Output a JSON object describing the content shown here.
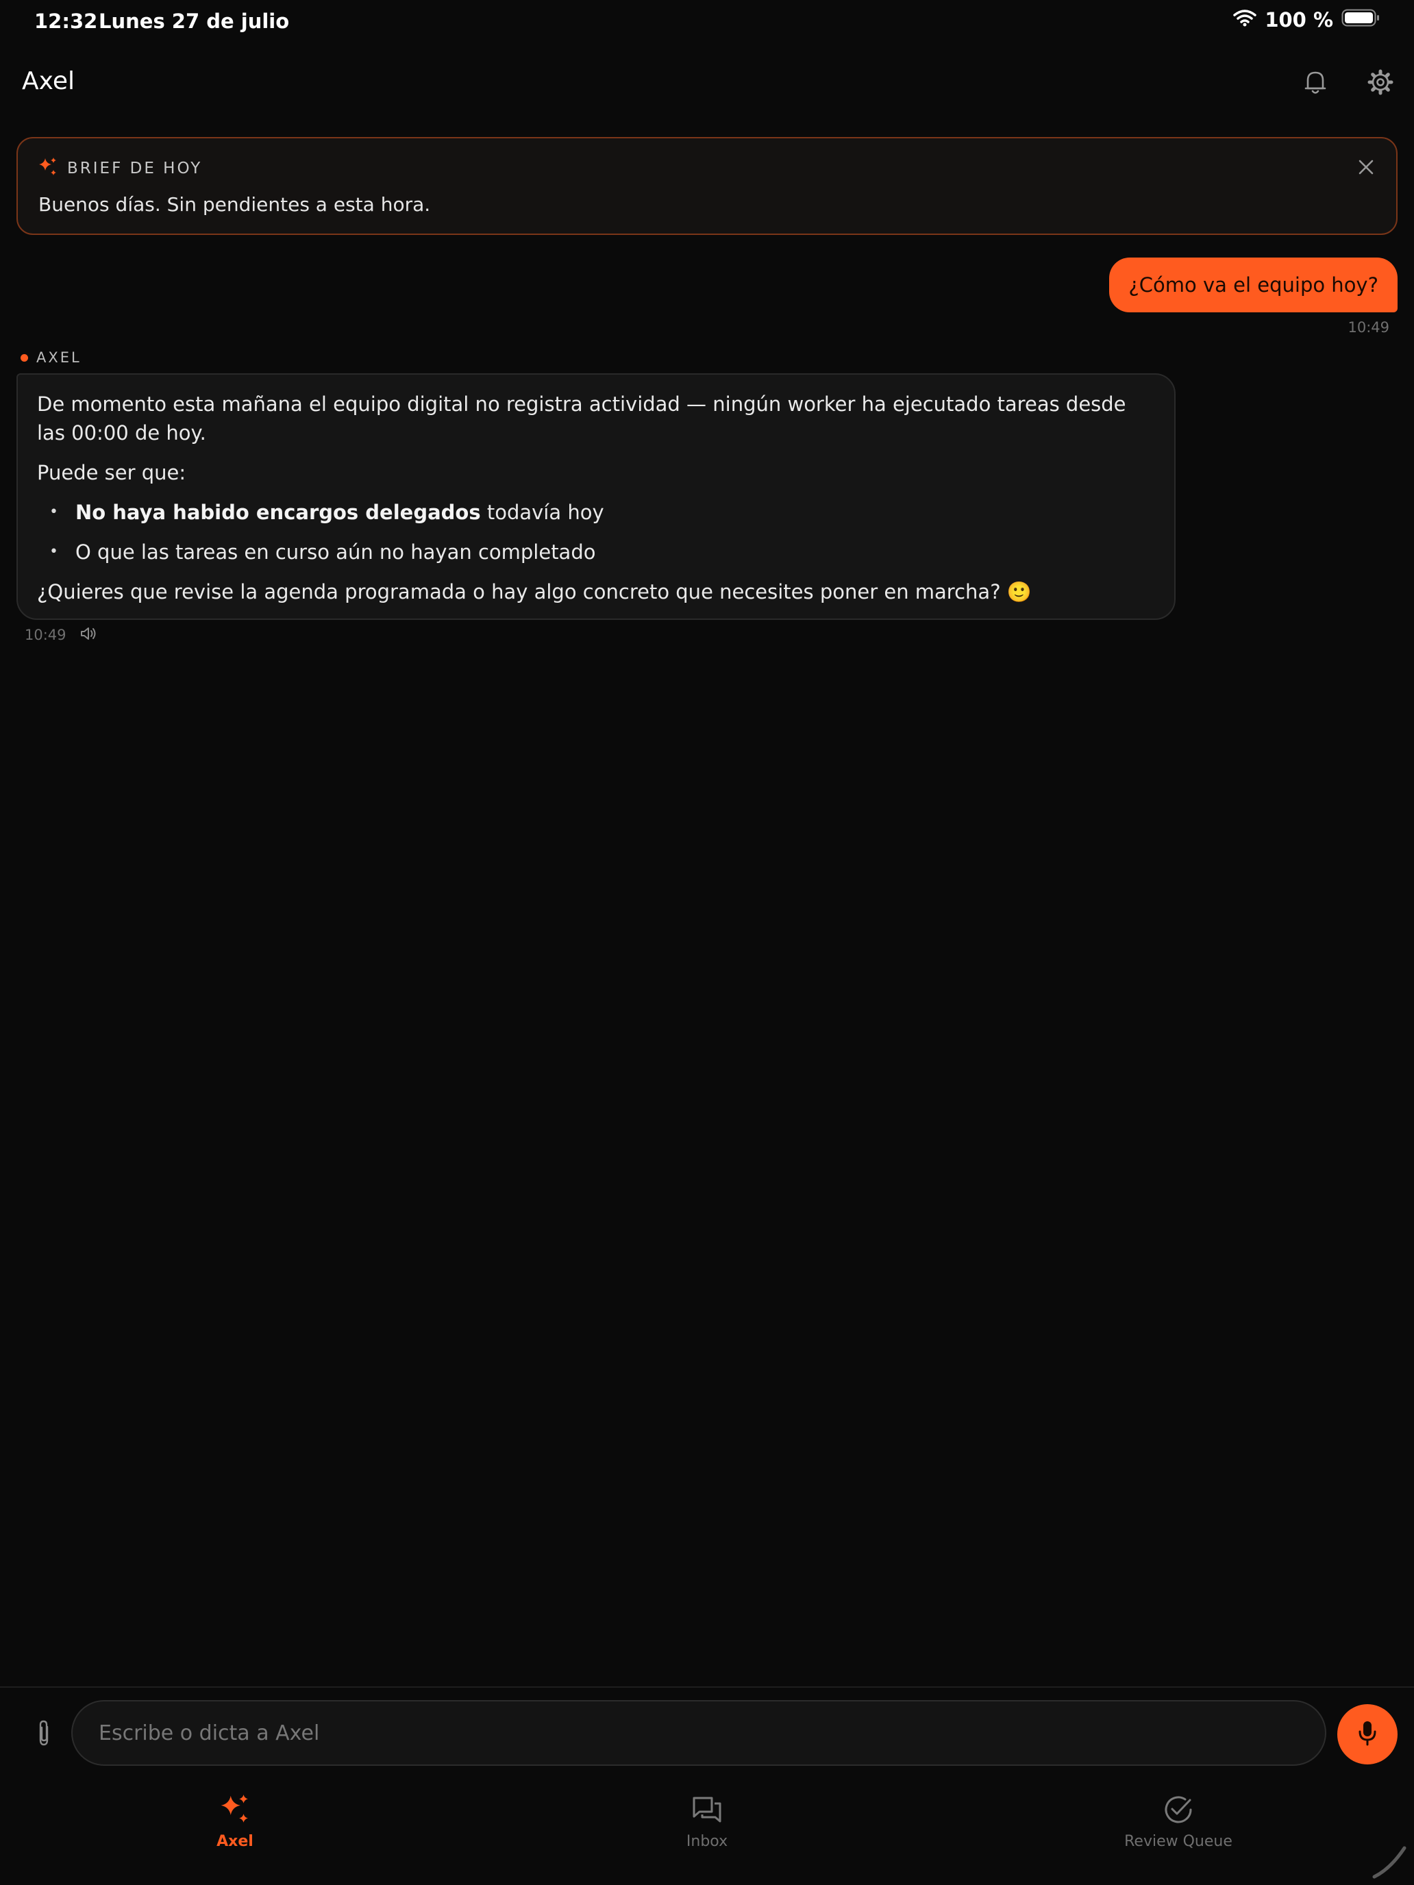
{
  "status_bar": {
    "time": "12:32",
    "date": "Lunes 27 de julio",
    "battery": "100 %"
  },
  "header": {
    "title": "Axel",
    "icons": [
      "bell-icon",
      "gear-icon"
    ]
  },
  "brief": {
    "label": "BRIEF DE HOY",
    "text": "Buenos días. Sin pendientes a esta hora."
  },
  "messages": {
    "user": {
      "text": "¿Cómo va el equipo hoy?",
      "time": "10:49"
    },
    "axel": {
      "sender": "AXEL",
      "paragraph1": "De momento esta mañana el equipo digital no registra actividad — ningún worker ha ejecutado tareas desde las 00:00 de hoy.",
      "paragraph2": "Puede ser que:",
      "bullet1_bold": "No haya habido encargos delegados",
      "bullet1_rest": " todavía hoy",
      "bullet2": "O que las tareas en curso aún no hayan completado",
      "paragraph3": "¿Quieres que revise la agenda programada o hay algo concreto que necesites poner en marcha? 🙂",
      "time": "10:49"
    }
  },
  "composer": {
    "placeholder": "Escribe o dicta a Axel"
  },
  "tabs": [
    {
      "label": "Axel",
      "icon": "sparkle-icon",
      "active": true
    },
    {
      "label": "Inbox",
      "icon": "chat-bubbles-icon",
      "active": false
    },
    {
      "label": "Review Queue",
      "icon": "check-circle-icon",
      "active": false
    }
  ],
  "colors": {
    "accent": "#ff5b1f",
    "background": "#0a0a0a",
    "card": "#151515",
    "brief_border": "#7a3518"
  }
}
